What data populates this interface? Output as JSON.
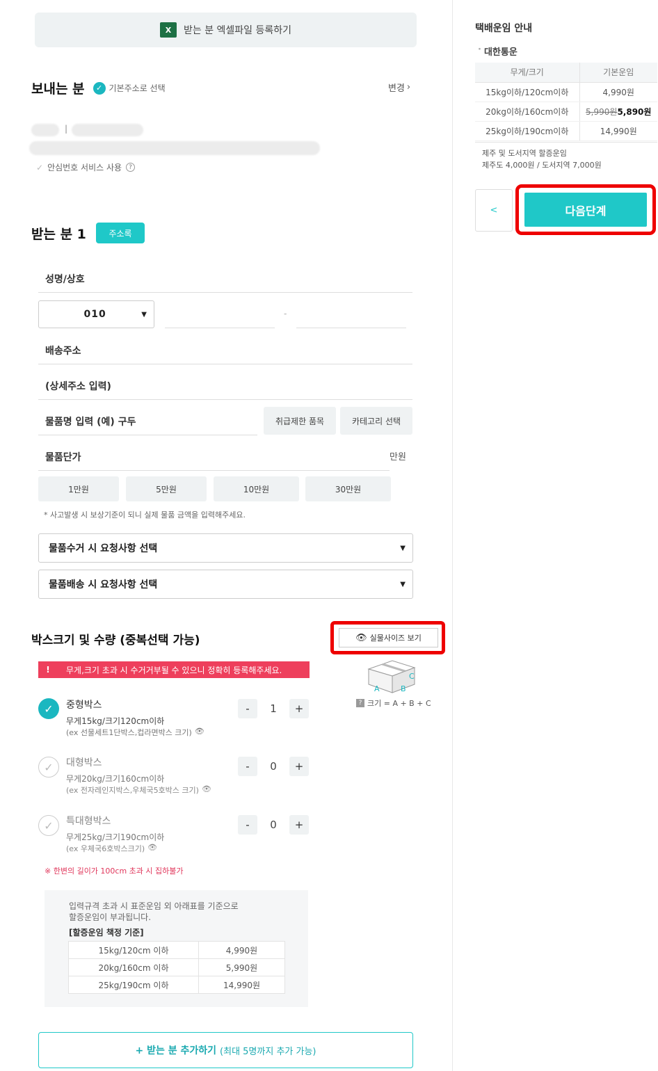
{
  "excel_upload": {
    "label": "받는 분 엑셀파일 등록하기",
    "icon": "excel-icon"
  },
  "sender": {
    "title": "보내는 분",
    "default_address_label": "기본주소로 선택",
    "change_label": "변경",
    "safe_number_label": "안심번호 서비스 사용"
  },
  "recipient": {
    "title": "받는 분 1",
    "address_book_label": "주소록",
    "name_label": "성명/상호",
    "phone_prefix": "010",
    "phone_dash": "-",
    "address_label": "배송주소",
    "address_detail_label": "(상세주소 입력)",
    "item_name_label": "물품명 입력 (예) 구두",
    "restricted_items_label": "취급제한 품목",
    "category_label": "카테고리 선택",
    "item_price_label": "물품단가",
    "price_unit": "만원",
    "price_presets": [
      "1만원",
      "5만원",
      "10만원",
      "30만원"
    ],
    "price_note": "* 사고발생 시 보상기준이 되니 실제 물품 금액을 입력해주세요.",
    "pickup_request_label": "물품수거 시 요청사항 선택",
    "delivery_request_label": "물품배송 시 요청사항 선택"
  },
  "boxes": {
    "title": "박스크기 및 수량 (중복선택 가능)",
    "actual_size_label": "실물사이즈 보기",
    "warning_mark": "!",
    "warning": "무게,크기 초과 시 수거거부될 수 있으니 정확히 등록해주세요.",
    "size_formula": "크기 = A + B + C",
    "diagram_labels": [
      "A",
      "B",
      "C"
    ],
    "items": [
      {
        "name": "중형박스",
        "spec": "무게15kg/크기120cm이하",
        "example": "(ex 선물세트1단박스,컵라면박스 크기)",
        "qty": "1",
        "selected": true
      },
      {
        "name": "대형박스",
        "spec": "무게20kg/크기160cm이하",
        "example": "(ex 전자레인지박스,우체국5호박스 크기)",
        "qty": "0",
        "selected": false
      },
      {
        "name": "특대형박스",
        "spec": "무게25kg/크기190cm이하",
        "example": "(ex 우체국6호박스크기)",
        "qty": "0",
        "selected": false
      }
    ],
    "minus": "-",
    "plus": "+",
    "length_note": "※ 한변의 길이가 100cm 초과 시 집하불가"
  },
  "surcharge": {
    "note": "입력규격 초과 시 표준운임 외 아래표를 기준으로\n할증운임이 부과됩니다.",
    "title": "[할증운임 책정 기준]",
    "rows": [
      [
        "15kg/120cm 이하",
        "4,990원"
      ],
      [
        "20kg/160cm 이하",
        "5,990원"
      ],
      [
        "25kg/190cm 이하",
        "14,990원"
      ]
    ]
  },
  "add_recipient": {
    "label": "+ 받는 분 추가하기",
    "sub": "(최대 5명까지 추가 가능)"
  },
  "rate_panel": {
    "title": "택배운임 안내",
    "carrier": "대한통운",
    "headers": [
      "무게/크기",
      "기본운임"
    ],
    "rows": [
      {
        "size": "15kg이하/120cm이하",
        "price": "4,990원"
      },
      {
        "size": "20kg이하/160cm이하",
        "old_price": "5,990원",
        "price": "5,890원"
      },
      {
        "size": "25kg이하/190cm이하",
        "price": "14,990원"
      }
    ],
    "surcharge_title": "제주 및 도서지역 할증운임",
    "surcharge_detail": "제주도 4,000원 / 도서지역 7,000원",
    "back_label": "<",
    "next_label": "다음단계"
  },
  "colors": {
    "accent": "#1fc8c8",
    "warning": "#ee3f5c",
    "highlight": "#ee0000"
  }
}
